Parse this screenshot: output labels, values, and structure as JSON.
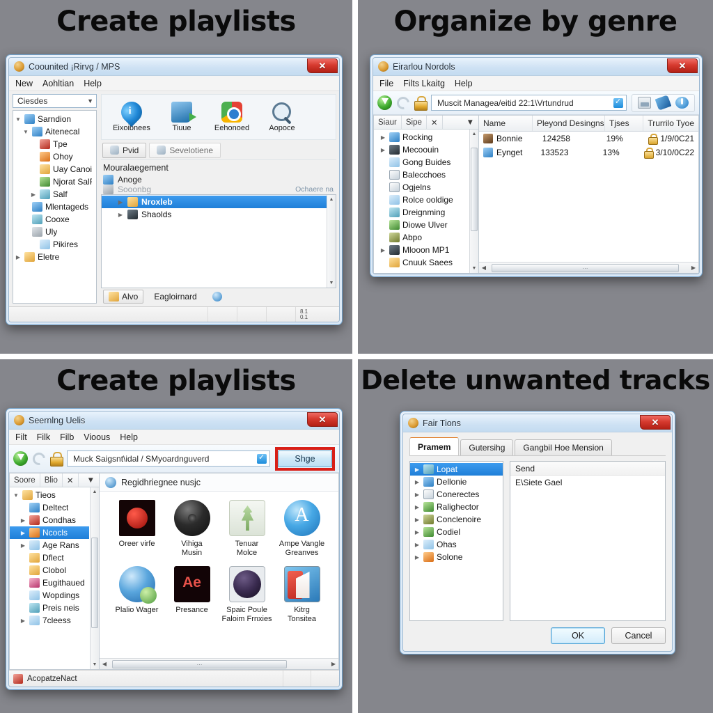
{
  "collage": {
    "background_color": "#85868c",
    "divider_color": "#ffffff",
    "captions": {
      "top_left": "Create playlists",
      "top_right": "Organize by genre",
      "bottom_left": "Create playlists",
      "bottom_right": "Delete unwanted tracks"
    }
  },
  "panel_tl": {
    "title": "Coounited ¡Rirvg / MPS",
    "close_label": "✕",
    "menu": [
      "New",
      "Aohltian",
      "Help"
    ],
    "combo_value": "Ciesdes",
    "tree": [
      {
        "label": "Sarndion",
        "indent": 0,
        "arrow": "▼",
        "icon": "i-blue"
      },
      {
        "label": "Aiteneсal",
        "indent": 1,
        "arrow": "▼",
        "icon": "i-blue"
      },
      {
        "label": "Tpe",
        "indent": 2,
        "arrow": "",
        "icon": "i-red"
      },
      {
        "label": "Ohoy",
        "indent": 2,
        "arrow": "",
        "icon": "i-orange"
      },
      {
        "label": "Uay Canoiot",
        "indent": 2,
        "arrow": "",
        "icon": "i-folder"
      },
      {
        "label": "Njorat SalFlalte",
        "indent": 2,
        "arrow": "",
        "icon": "i-green"
      },
      {
        "label": "Salf",
        "indent": 2,
        "arrow": "▶",
        "icon": "i-teal"
      },
      {
        "label": "Mlentageds",
        "indent": 1,
        "arrow": "",
        "icon": "i-blue"
      },
      {
        "label": "Cooxe",
        "indent": 1,
        "arrow": "",
        "icon": "i-teal"
      },
      {
        "label": "Uly",
        "indent": 1,
        "arrow": "",
        "icon": "i-grey"
      },
      {
        "label": "Pikires",
        "indent": 2,
        "arrow": "",
        "icon": "i-ltblue"
      },
      {
        "label": "Eletre",
        "indent": 0,
        "arrow": "▶",
        "icon": "i-folder"
      }
    ],
    "big_tools": [
      {
        "label": "Eixoibnees",
        "icon": "info-pin-icon"
      },
      {
        "label": "Tiuue",
        "icon": "boot-arrow-icon"
      },
      {
        "label": "Eehonoed",
        "icon": "chrome-circle-icon"
      },
      {
        "label": "Aopoce",
        "icon": "magnifier-icon"
      }
    ],
    "tab_buttons": [
      {
        "label": "Pvid",
        "icon": "arrow-icon",
        "active": true
      },
      {
        "label": "Sevelotiene",
        "icon": "magnifier-icon",
        "active": false
      }
    ],
    "section_title": "Mouralaegement",
    "rows": [
      {
        "label": "Anoge",
        "icon": "i-blue",
        "dim": false,
        "right": ""
      },
      {
        "label": "Sooonbg",
        "icon": "i-grey",
        "dim": true,
        "right": "Ochaere na"
      }
    ],
    "list": [
      {
        "label": "Nroxleb",
        "icon": "i-folder",
        "selected": true,
        "arrow": "▶"
      },
      {
        "label": "Shaolds",
        "icon": "i-dark",
        "selected": false,
        "arrow": "▶"
      }
    ],
    "bottom_buttons": [
      {
        "label": "Alvo",
        "icon": "i-folder"
      },
      {
        "label": "Eagloirnard",
        "icon": ""
      },
      {
        "label": "",
        "icon": "circle-info-icon"
      }
    ],
    "status_right": "8.1\n0.1"
  },
  "panel_tr": {
    "title": "Eirarlou Nordols",
    "close_label": "✕",
    "menu": [
      "File",
      "Filts Lkaitg",
      "Help"
    ],
    "address_value": "Muscit Managea/eitid 22:1\\Vrtundrud",
    "address_icons": [
      "download-icon",
      "undo-icon",
      "lock-icon"
    ],
    "right_icons": [
      "picture-icon",
      "pen-icon",
      "power-icon"
    ],
    "tree_header": [
      "Siaur",
      "Sipe",
      "✕",
      "▼"
    ],
    "tree": [
      {
        "label": "Rocking",
        "arrow": "▶",
        "icon": "i-blue"
      },
      {
        "label": "Mecoouin",
        "arrow": "▶",
        "icon": "i-dark"
      },
      {
        "label": "Gong Buides",
        "arrow": "",
        "icon": "i-ltblue"
      },
      {
        "label": "Balecchoes",
        "arrow": "",
        "icon": "i-paper"
      },
      {
        "label": "Ogjelns",
        "arrow": "",
        "icon": "i-paper"
      },
      {
        "label": "Rolce ooldige",
        "arrow": "",
        "icon": "i-ltblue"
      },
      {
        "label": "Dreignming",
        "arrow": "",
        "icon": "i-teal"
      },
      {
        "label": "Diowe Ulver",
        "arrow": "",
        "icon": "i-green"
      },
      {
        "label": "Abpo",
        "arrow": "",
        "icon": "i-olive"
      },
      {
        "label": "Mlooon MP1",
        "arrow": "▶",
        "icon": "i-dark"
      },
      {
        "label": "Cnuuk Saees",
        "arrow": "",
        "icon": "i-folder"
      }
    ],
    "columns": [
      "Name",
      "Pleyond Desingns",
      "Tjses",
      "Trurrilo Tyoe"
    ],
    "rows": [
      {
        "name": "Bonnie",
        "icon": "i-brown",
        "plays": "124258",
        "type": "19%",
        "date": "1/9/0C21"
      },
      {
        "name": "Eynget",
        "icon": "i-blue",
        "plays": "133523",
        "type": "13%",
        "date": "3/10/0C22"
      }
    ]
  },
  "panel_bl": {
    "title": "Seernlng Uelis",
    "close_label": "✕",
    "menu": [
      "Filt",
      "Filk",
      "Filb",
      "Vioous",
      "Help"
    ],
    "address_value": "Muck Saigsnt\\idal / SMyoardnguverd",
    "highlight_button": "Shge",
    "highlight_color": "#d81f17",
    "tree_header": [
      "Soore",
      "Blio",
      "✕",
      "▼"
    ],
    "tree": [
      {
        "label": "Tieos",
        "arrow": "▼",
        "icon": "i-folder",
        "selected": false,
        "indent": 0
      },
      {
        "label": "Deltect",
        "arrow": "",
        "icon": "i-blue",
        "selected": false,
        "indent": 1
      },
      {
        "label": "Condhas",
        "arrow": "▶",
        "icon": "i-red",
        "selected": false,
        "indent": 1
      },
      {
        "label": "Ncocls",
        "arrow": "▶",
        "icon": "i-orange",
        "selected": true,
        "indent": 1
      },
      {
        "label": "Age Rans",
        "arrow": "▶",
        "icon": "i-ltblue",
        "selected": false,
        "indent": 1
      },
      {
        "label": "Dflect",
        "arrow": "",
        "icon": "i-folder",
        "selected": false,
        "indent": 1
      },
      {
        "label": "Clobol",
        "arrow": "",
        "icon": "i-folder",
        "selected": false,
        "indent": 1
      },
      {
        "label": "Eugithaued",
        "arrow": "",
        "icon": "i-pink",
        "selected": false,
        "indent": 1
      },
      {
        "label": "Wopdings",
        "arrow": "",
        "icon": "i-ltblue",
        "selected": false,
        "indent": 1
      },
      {
        "label": "Preis neis",
        "arrow": "",
        "icon": "i-teal",
        "selected": false,
        "indent": 1
      },
      {
        "label": "7cleess",
        "arrow": "▶",
        "icon": "i-ltblue",
        "selected": false,
        "indent": 1
      }
    ],
    "grid_header": "Regidhriegnee nusjc",
    "grid_items": [
      {
        "label": "Oreer virfe",
        "icon": "gi-1"
      },
      {
        "label": "Vihiga\nMusin",
        "icon": "gi-2"
      },
      {
        "label": "Tenuar\nMolce",
        "icon": "gi-3"
      },
      {
        "label": "Ampe Vangle\nGreanves",
        "icon": "gi-4"
      },
      {
        "label": "Plalio Wager",
        "icon": "gi-5"
      },
      {
        "label": "Presance",
        "icon": "gi-6"
      },
      {
        "label": "Spaic Poule\nFaloim Frnxies",
        "icon": "gi-7"
      },
      {
        "label": "Kitrg\nTonsitea",
        "icon": "gi-8"
      }
    ],
    "status_label": "AcopatzeNact"
  },
  "panel_br": {
    "title": "Fair Tions",
    "close_label": "✕",
    "tabs": [
      {
        "label": "Pramem",
        "active": true
      },
      {
        "label": "Gutersihg",
        "active": false
      },
      {
        "label": "Gangbil Hoe Mension",
        "active": false
      }
    ],
    "tree": [
      {
        "label": "Lopat",
        "arrow": "▶",
        "icon": "i-teal",
        "selected": true
      },
      {
        "label": "Dellonie",
        "arrow": "▶",
        "icon": "i-blue",
        "selected": false
      },
      {
        "label": "Conerectes",
        "arrow": "▶",
        "icon": "i-paper",
        "selected": false
      },
      {
        "label": "Ralighector",
        "arrow": "▶",
        "icon": "i-green",
        "selected": false
      },
      {
        "label": "Conclenoire",
        "arrow": "▶",
        "icon": "i-olive",
        "selected": false
      },
      {
        "label": "Codiel",
        "arrow": "▶",
        "icon": "i-green",
        "selected": false
      },
      {
        "label": "Ohas",
        "arrow": "▶",
        "icon": "i-ltblue",
        "selected": false
      },
      {
        "label": "Solone",
        "arrow": "▶",
        "icon": "i-orange",
        "selected": false
      }
    ],
    "detail_header": "Send",
    "detail_items": [
      "E\\Siete Gael"
    ],
    "ok_label": "OK",
    "cancel_label": "Cancel"
  }
}
